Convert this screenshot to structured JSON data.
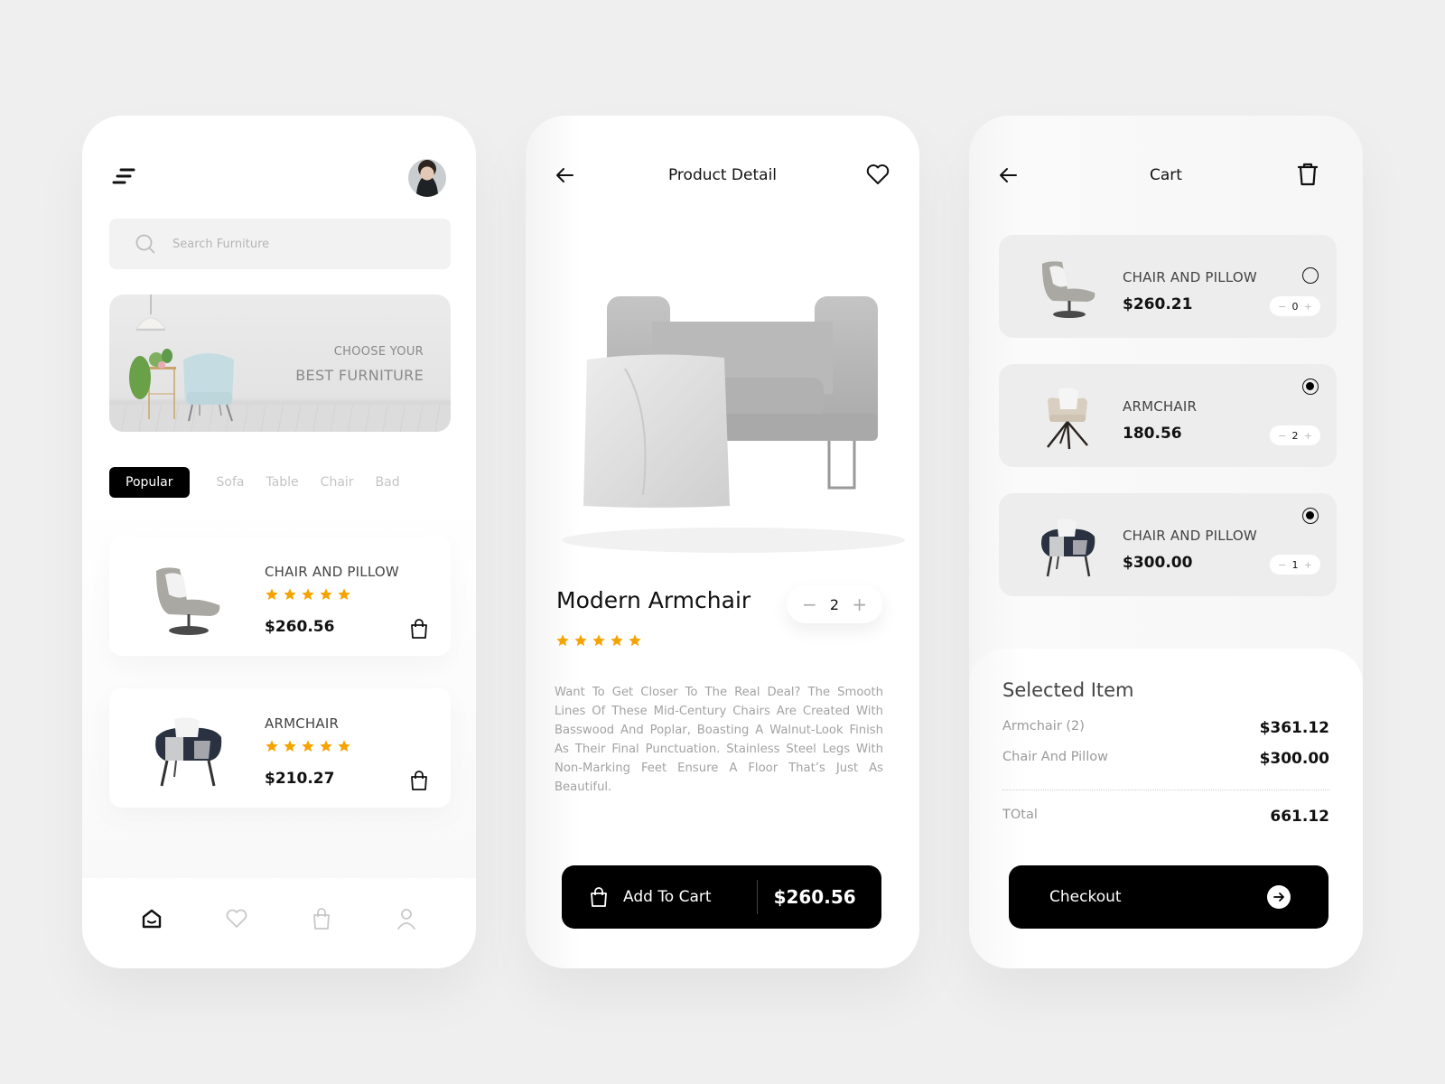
{
  "colors": {
    "accent": "#000000",
    "star": "#F5A300",
    "background": "#EFEFEF"
  },
  "home": {
    "menu_icon": "menu-icon",
    "avatar_alt": "user-avatar",
    "search": {
      "placeholder": "Search Furniture",
      "value": ""
    },
    "banner": {
      "line1": "CHOOSE YOUR",
      "line2": "BEST FURNITURE"
    },
    "categories": [
      {
        "label": "Popular",
        "active": true
      },
      {
        "label": "Sofa",
        "active": false
      },
      {
        "label": "Table",
        "active": false
      },
      {
        "label": "Chair",
        "active": false
      },
      {
        "label": "Bad",
        "active": false
      }
    ],
    "products": [
      {
        "name": "CHAIR AND PILLOW",
        "rating": 5,
        "price": "$260.56"
      },
      {
        "name": "ARMCHAIR",
        "rating": 5,
        "price": "$210.27"
      }
    ],
    "bottom_nav": [
      {
        "icon": "home-icon",
        "active": true
      },
      {
        "icon": "heart-icon",
        "active": false
      },
      {
        "icon": "bag-icon",
        "active": false
      },
      {
        "icon": "user-icon",
        "active": false
      }
    ]
  },
  "detail": {
    "title": "Product Detail",
    "product_name": "Modern Armchair",
    "quantity": "2",
    "qty_minus": "−",
    "qty_plus": "+",
    "rating": 5,
    "description": "Want To Get Closer To The Real Deal? The Smooth Lines Of These Mid-Century Chairs Are Created With Basswood And Poplar, Boasting A Walnut-Look Finish As Their Final Punctuation. Stainless Steel Legs With Non-Marking Feet Ensure A Floor That’s Just As Beautiful.",
    "add_to_cart_label": "Add To Cart",
    "price": "$260.56"
  },
  "cart": {
    "title": "Cart",
    "items": [
      {
        "name": "CHAIR AND PILLOW",
        "price": "$260.21",
        "quantity": "0",
        "selected": false
      },
      {
        "name": "ARMCHAIR",
        "price": "180.56",
        "quantity": "2",
        "selected": true
      },
      {
        "name": "CHAIR AND PILLOW",
        "price": "$300.00",
        "quantity": "1",
        "selected": true
      }
    ],
    "qty_minus": "−",
    "qty_plus": "+",
    "summary": {
      "title": "Selected Item",
      "rows": [
        {
          "label": "Armchair  (2)",
          "value": "$361.12"
        },
        {
          "label": "Chair And Pillow",
          "value": "$300.00"
        }
      ],
      "total_label": "TOtal",
      "total_value": "661.12"
    },
    "checkout_label": "Checkout"
  }
}
